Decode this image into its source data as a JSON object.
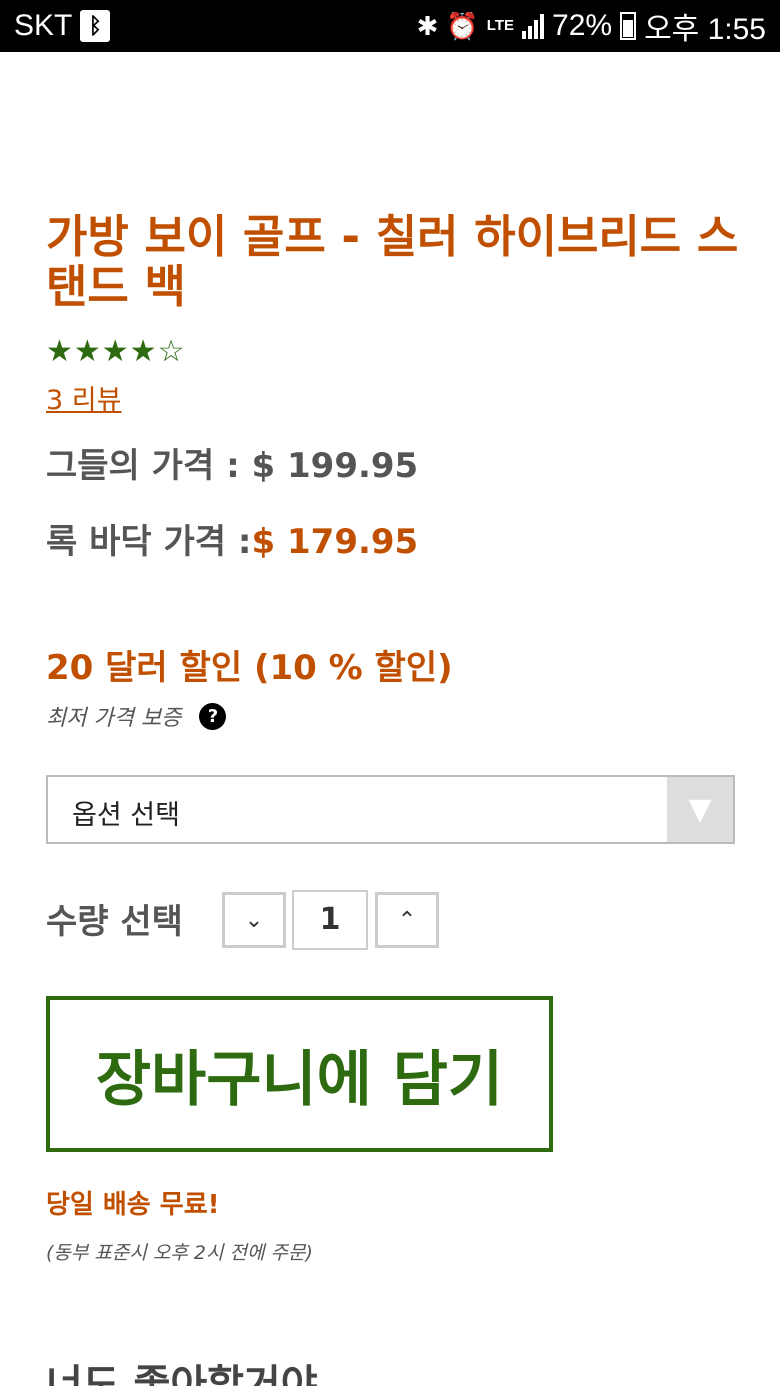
{
  "status_bar": {
    "carrier": "SKT",
    "bluetooth_glyph": "ᛒ",
    "network_type": "LTE",
    "battery_percent": "72%",
    "time": "오후 1:55"
  },
  "product": {
    "title": "가방 보이 골프 - 칠러 하이브리드 스탠드 백",
    "rating": 4.5,
    "stars_display": "★★★★☆",
    "reviews_link": "3 리뷰",
    "list_price_label": "그들의 가격 : ",
    "list_price": "$ 199.95",
    "our_price_label": "록 바닥 가격 :",
    "our_price": "$ 179.95",
    "savings": "20 달러 할인 (10 % 할인)",
    "guarantee": "최저 가격 보증",
    "help_glyph": "?"
  },
  "options": {
    "select_label": "옵션 선택",
    "arrow_glyph": "▼"
  },
  "quantity": {
    "label": "수량 선택",
    "value": "1",
    "down_glyph": "⌄",
    "up_glyph": "⌃"
  },
  "cart": {
    "button_label": "장바구니에 담기"
  },
  "shipping": {
    "headline": "당일 배송 무료!",
    "note": "(동부 표준시 오후 2시 전에 주문)"
  },
  "related": {
    "heading": "너도 좋아할거야"
  },
  "colors": {
    "accent_orange": "#c05000",
    "accent_green": "#2e6b10"
  }
}
